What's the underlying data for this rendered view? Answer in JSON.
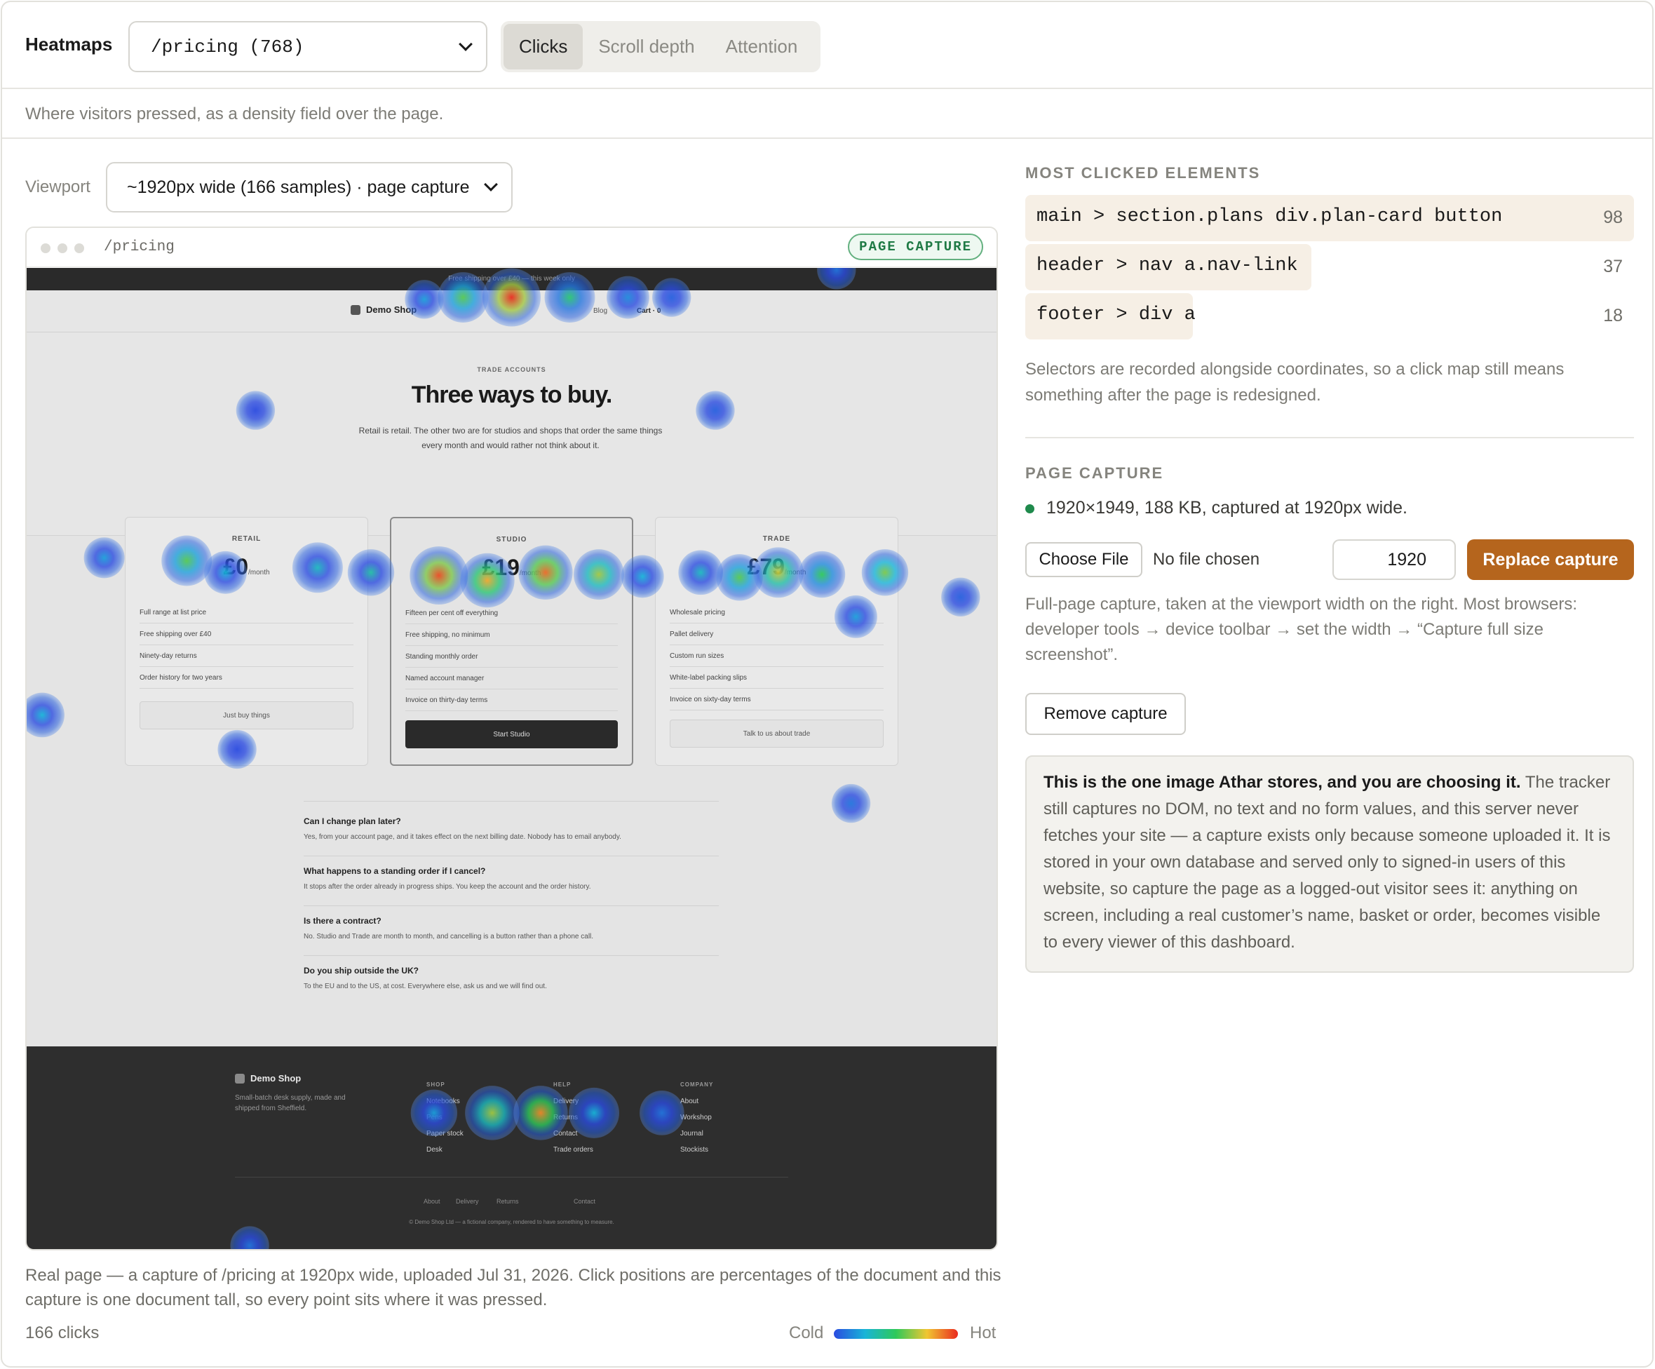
{
  "header": {
    "brand": "Heatmaps",
    "page_select": "/pricing (768)",
    "modes": [
      "Clicks",
      "Scroll depth",
      "Attention"
    ],
    "active_mode": "Clicks",
    "subtitle": "Where visitors pressed, as a density field over the page."
  },
  "viewport": {
    "label": "Viewport",
    "value": "~1920px wide (166 samples) · page capture"
  },
  "browser": {
    "url": "/pricing",
    "badge": "PAGE CAPTURE"
  },
  "capture_page": {
    "promo": "Free shipping over £40 — this week only",
    "logo": "Demo Shop",
    "nav": [
      "Blog",
      "Cart · 0"
    ],
    "eyebrow": "TRADE ACCOUNTS",
    "title": "Three ways to buy.",
    "lede": "Retail is retail. The other two are for studios and shops that order the same things every month and would rather not think about it.",
    "plans": [
      {
        "name": "RETAIL",
        "price": "£0",
        "per": "/month",
        "features": [
          "Full range at list price",
          "Free shipping over £40",
          "Ninety-day returns",
          "Order history for two years"
        ],
        "cta": "Just buy things"
      },
      {
        "name": "STUDIO",
        "price": "£19",
        "per": "/month",
        "features": [
          "Fifteen per cent off everything",
          "Free shipping, no minimum",
          "Standing monthly order",
          "Named account manager",
          "Invoice on thirty-day terms"
        ],
        "cta": "Start Studio"
      },
      {
        "name": "TRADE",
        "price": "£79",
        "per": "/month",
        "features": [
          "Wholesale pricing",
          "Pallet delivery",
          "Custom run sizes",
          "White-label packing slips",
          "Invoice on sixty-day terms"
        ],
        "cta": "Talk to us about trade"
      }
    ],
    "faq": [
      {
        "q": "Can I change plan later?",
        "a": "Yes, from your account page, and it takes effect on the next billing date. Nobody has to email anybody."
      },
      {
        "q": "What happens to a standing order if I cancel?",
        "a": "It stops after the order already in progress ships. You keep the account and the order history."
      },
      {
        "q": "Is there a contract?",
        "a": "No. Studio and Trade are month to month, and cancelling is a button rather than a phone call."
      },
      {
        "q": "Do you ship outside the UK?",
        "a": "To the EU and to the US, at cost. Everywhere else, ask us and we will find out."
      }
    ],
    "footer": {
      "logo": "Demo Shop",
      "blurb": "Small-batch desk supply, made and shipped from Sheffield.",
      "columns": [
        {
          "heading": "SHOP",
          "links": [
            "Notebooks",
            "Pens",
            "Paper stock",
            "Desk"
          ]
        },
        {
          "heading": "HELP",
          "links": [
            "Delivery",
            "Returns",
            "Contact",
            "Trade orders"
          ]
        },
        {
          "heading": "COMPANY",
          "links": [
            "About",
            "Workshop",
            "Journal",
            "Stockists"
          ]
        }
      ],
      "bottom_links": [
        "About",
        "Delivery",
        "Returns",
        "Contact"
      ],
      "copyright": "© Demo Shop Ltd — a fictional company, rendered to have something to measure."
    }
  },
  "heatmap": {
    "count_text": "166 clicks",
    "legend_cold": "Cold",
    "legend_hot": "Hot",
    "note": "Real page — a capture of /pricing at 1920px wide, uploaded Jul 31, 2026. Click positions are percentages of the document and this capture is one document tall, so every point sits where it was pressed.",
    "gradient": [
      "#2b4be0",
      "#18b4d8",
      "#2ec95a",
      "#f0c632",
      "#ea2b1f"
    ],
    "blobs": [
      {
        "x": 50.0,
        "y": 3.0,
        "r": 3.0,
        "heat": 1.0
      },
      {
        "x": 45.0,
        "y": 3.0,
        "r": 2.6,
        "heat": 0.55
      },
      {
        "x": 56.0,
        "y": 3.0,
        "r": 2.6,
        "heat": 0.45
      },
      {
        "x": 62.0,
        "y": 3.0,
        "r": 2.2,
        "heat": 0.15
      },
      {
        "x": 41.0,
        "y": 3.2,
        "r": 2.0,
        "heat": 0.2
      },
      {
        "x": 66.5,
        "y": 3.0,
        "r": 2.0,
        "heat": 0.05
      },
      {
        "x": 83.5,
        "y": 0.2,
        "r": 2.0,
        "heat": 0.1
      },
      {
        "x": 23.6,
        "y": 14.5,
        "r": 2.0,
        "heat": 0.0
      },
      {
        "x": 71.0,
        "y": 14.5,
        "r": 2.0,
        "heat": 0.05
      },
      {
        "x": 8.0,
        "y": 29.5,
        "r": 2.1,
        "heat": 0.2
      },
      {
        "x": 16.5,
        "y": 29.8,
        "r": 2.6,
        "heat": 0.55
      },
      {
        "x": 20.5,
        "y": 31.0,
        "r": 2.2,
        "heat": 0.25
      },
      {
        "x": 30.0,
        "y": 30.5,
        "r": 2.6,
        "heat": 0.3
      },
      {
        "x": 35.5,
        "y": 31.0,
        "r": 2.4,
        "heat": 0.35
      },
      {
        "x": 42.5,
        "y": 31.3,
        "r": 3.0,
        "heat": 0.95
      },
      {
        "x": 47.5,
        "y": 31.8,
        "r": 2.8,
        "heat": 0.8
      },
      {
        "x": 53.5,
        "y": 31.0,
        "r": 2.8,
        "heat": 0.9
      },
      {
        "x": 59.0,
        "y": 31.2,
        "r": 2.6,
        "heat": 0.65
      },
      {
        "x": 63.5,
        "y": 31.4,
        "r": 2.2,
        "heat": 0.25
      },
      {
        "x": 69.5,
        "y": 31.0,
        "r": 2.3,
        "heat": 0.3
      },
      {
        "x": 73.5,
        "y": 31.5,
        "r": 2.4,
        "heat": 0.55
      },
      {
        "x": 77.5,
        "y": 31.0,
        "r": 2.6,
        "heat": 0.7
      },
      {
        "x": 82.0,
        "y": 31.2,
        "r": 2.4,
        "heat": 0.5
      },
      {
        "x": 88.5,
        "y": 31.0,
        "r": 2.4,
        "heat": 0.6
      },
      {
        "x": 85.5,
        "y": 35.5,
        "r": 2.2,
        "heat": 0.2
      },
      {
        "x": 96.3,
        "y": 33.5,
        "r": 2.0,
        "heat": 0.05
      },
      {
        "x": 1.6,
        "y": 45.5,
        "r": 2.3,
        "heat": 0.25
      },
      {
        "x": 21.7,
        "y": 49.0,
        "r": 2.0,
        "heat": 0.0
      },
      {
        "x": 85.0,
        "y": 54.5,
        "r": 2.0,
        "heat": 0.1
      },
      {
        "x": 23.0,
        "y": 99.5,
        "r": 2.0,
        "heat": 0.1
      },
      {
        "x": 42.0,
        "y": 86.0,
        "r": 2.4,
        "heat": 0.2
      },
      {
        "x": 48.0,
        "y": 86.0,
        "r": 2.8,
        "heat": 0.65
      },
      {
        "x": 53.0,
        "y": 86.0,
        "r": 2.8,
        "heat": 0.85
      },
      {
        "x": 58.5,
        "y": 86.0,
        "r": 2.6,
        "heat": 0.25
      },
      {
        "x": 65.5,
        "y": 86.0,
        "r": 2.3,
        "heat": 0.1
      }
    ]
  },
  "sidebar": {
    "most_clicked_heading": "MOST CLICKED ELEMENTS",
    "elements": [
      {
        "selector": "main > section.plans div.plan-card button",
        "count": 98
      },
      {
        "selector": "header > nav a.nav-link",
        "count": 37
      },
      {
        "selector": "footer > div a",
        "count": 18
      }
    ],
    "selectors_note": "Selectors are recorded alongside coordinates, so a click map still means something after the page is redesigned.",
    "page_capture_heading": "PAGE CAPTURE",
    "capture_status": "1920×1949, 188 KB, captured at 1920px wide.",
    "choose_file": "Choose File",
    "no_file": "No file chosen",
    "width_value": "1920",
    "replace_button": "Replace capture",
    "capture_help": "Full-page capture, taken at the viewport width on the right. Most browsers: developer tools → device toolbar → set the width → “Capture full size screenshot”.",
    "remove_button": "Remove capture",
    "warning_bold": "This is the one image Athar stores, and you are choosing it.",
    "warning_text": "The tracker still captures no DOM, no text and no form values, and this server never fetches your site — a capture exists only because someone uploaded it. It is stored in your own database and served only to signed-in users of this website, so capture the page as a logged-out visitor sees it: anything on screen, including a real customer’s name, basket or order, becomes visible to every viewer of this dashboard.",
    "accent": "#b5651d",
    "status_color": "#1f8a4c"
  }
}
